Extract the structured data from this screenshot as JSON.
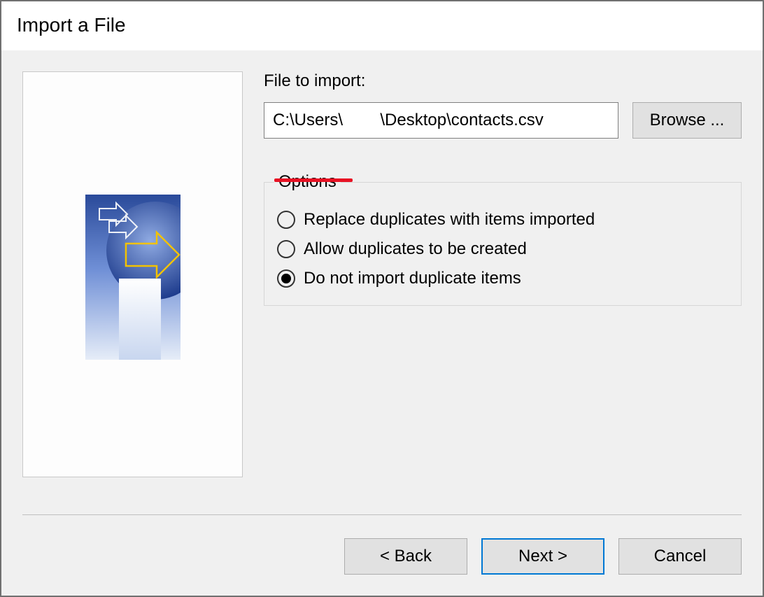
{
  "dialog": {
    "title": "Import a File"
  },
  "file": {
    "label": "File to import:",
    "path": "C:\\Users\\        \\Desktop\\contacts.csv",
    "browse_label": "Browse ..."
  },
  "options": {
    "legend": "Options",
    "items": [
      {
        "label": "Replace duplicates with items imported",
        "selected": false
      },
      {
        "label": "Allow duplicates to be created",
        "selected": false
      },
      {
        "label": "Do not import duplicate items",
        "selected": true
      }
    ]
  },
  "buttons": {
    "back": "< Back",
    "next": "Next >",
    "cancel": "Cancel"
  },
  "annotation": {
    "underline_color": "#e81123"
  }
}
